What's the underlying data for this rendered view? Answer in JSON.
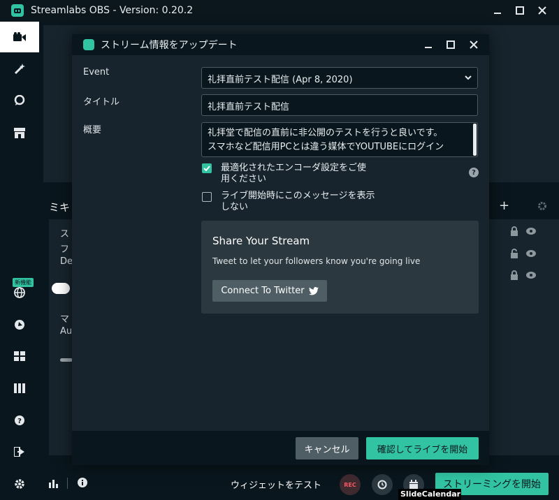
{
  "app": {
    "title": "Streamlabs OBS - Version: 0.20.2",
    "accent_color": "#31c3a2"
  },
  "sidebar": {
    "items": [
      {
        "icon": "video-camera-icon"
      },
      {
        "icon": "magic-wand-icon"
      },
      {
        "icon": "chat-bubble-icon"
      },
      {
        "icon": "store-icon"
      },
      {
        "icon": "globe-icon",
        "badge": "新機能"
      },
      {
        "icon": "dashboard-icon"
      },
      {
        "icon": "layout-grid-icon"
      },
      {
        "icon": "columns-icon"
      },
      {
        "icon": "help-icon"
      },
      {
        "icon": "logout-icon"
      },
      {
        "icon": "settings-gear-icon"
      }
    ]
  },
  "mixer": {
    "title": "ミキ",
    "rows": [
      {
        "label": "ス"
      },
      {
        "label": "フ"
      },
      {
        "label": "De"
      },
      {
        "label": "マ"
      },
      {
        "label": "Au"
      }
    ]
  },
  "bottombar": {
    "widget_test": "ウィジェットをテスト",
    "rec_label": "REC",
    "go_live": "ストリーミングを開始"
  },
  "overlay_text": "SlideCalendar",
  "modal": {
    "title": "ストリーム情報をアップデート",
    "event_label": "Event",
    "event_value": "礼拝直前テスト配信 (Apr 8, 2020)",
    "title_label": "タイトル",
    "title_value": "礼拝直前テスト配信",
    "description_label": "概要",
    "description_lines": [
      "礼拝堂で配信の直前に非公開のテストを行うと良いです。",
      "スマホなど配信用PCとは違う媒体でYOUTUBEにログイン"
    ],
    "checkbox_optimize": {
      "label_line1": "最適化されたエンコーダ設定をご使",
      "label_line2": "用ください",
      "checked": true
    },
    "checkbox_show_message": {
      "label_line1": "ライブ開始時にこのメッセージを表示",
      "label_line2": "しない",
      "checked": false
    },
    "share": {
      "title": "Share Your Stream",
      "description": "Tweet to let your followers know you're going live",
      "twitter_button": "Connect To Twitter"
    },
    "cancel_button": "キャンセル",
    "confirm_button": "確認してライブを開始"
  }
}
